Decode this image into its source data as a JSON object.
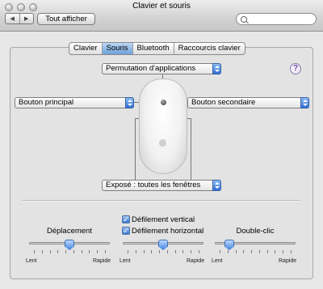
{
  "window": {
    "title": "Clavier et souris",
    "nav_back": "◀",
    "nav_forward": "▶",
    "show_all": "Tout afficher",
    "search": {
      "placeholder": "",
      "value": ""
    }
  },
  "tabs": [
    {
      "label": "Clavier",
      "active": false
    },
    {
      "label": "Souris",
      "active": true
    },
    {
      "label": "Bluetooth",
      "active": false
    },
    {
      "label": "Raccourcis clavier",
      "active": false
    }
  ],
  "mouse": {
    "scroll_ball_popup": "Permutation d'applications",
    "left_button_popup": "Bouton principal",
    "right_button_popup": "Bouton secondaire",
    "side_buttons_popup": "Exposé : toutes les fenêtres",
    "help": "?"
  },
  "controls": {
    "tracking": {
      "label": "Déplacement",
      "min_label": "Lent",
      "max_label": "Rapide",
      "value": 0.5
    },
    "scrolling": {
      "vertical_label": "Défilement vertical",
      "vertical_checked": true,
      "horizontal_label": "Défilement horizontal",
      "horizontal_checked": true,
      "min_label": "Lent",
      "max_label": "Rapide",
      "value": 0.5
    },
    "double_click": {
      "label": "Double-clic",
      "min_label": "Lent",
      "max_label": "Rapide",
      "value": 0.14
    }
  },
  "colors": {
    "accent": "#3c7ad4",
    "help_glyph": "#6a3da8"
  }
}
